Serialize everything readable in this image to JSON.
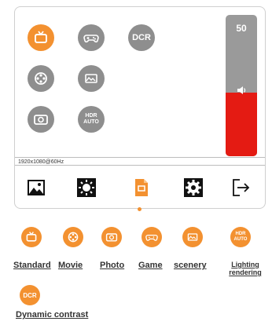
{
  "osd": {
    "volume": {
      "value": "50",
      "level": 0.45,
      "fill_color": "#e41b13",
      "track_color": "#9a9a9a"
    },
    "buttons": [
      {
        "name": "tv-mode-button",
        "icon": "tv-icon",
        "active": true
      },
      {
        "name": "game-mode-button",
        "icon": "gamepad-icon",
        "active": false
      },
      {
        "name": "dcr-button",
        "label": "DCR",
        "active": false
      },
      {
        "name": "movie-mode-button",
        "icon": "film-reel-icon",
        "active": false
      },
      {
        "name": "scenery-mode-button",
        "icon": "landscape-icon",
        "active": false
      },
      {
        "name": "photo-mode-button",
        "icon": "camera-icon",
        "active": false
      },
      {
        "name": "hdr-auto-button",
        "label_line1": "HDR",
        "label_line2": "AUTO",
        "active": false
      }
    ],
    "resolution": "1920x1080@60Hz",
    "toolbar": [
      "image-icon",
      "brightness-icon",
      "document-settings-icon",
      "gear-icon",
      "exit-icon"
    ],
    "accent": "#f39130"
  },
  "modes": {
    "standard": "Standard",
    "movie": "Movie",
    "photo": "Photo",
    "game": "Game",
    "scenery": "scenery",
    "lighting_line1": "Lighting",
    "lighting_line2": "rendering",
    "hdr_line1": "HDR",
    "hdr_line2": "AUTO",
    "dcr": "DCR",
    "dynamic_contrast": "Dynamic contrast"
  }
}
